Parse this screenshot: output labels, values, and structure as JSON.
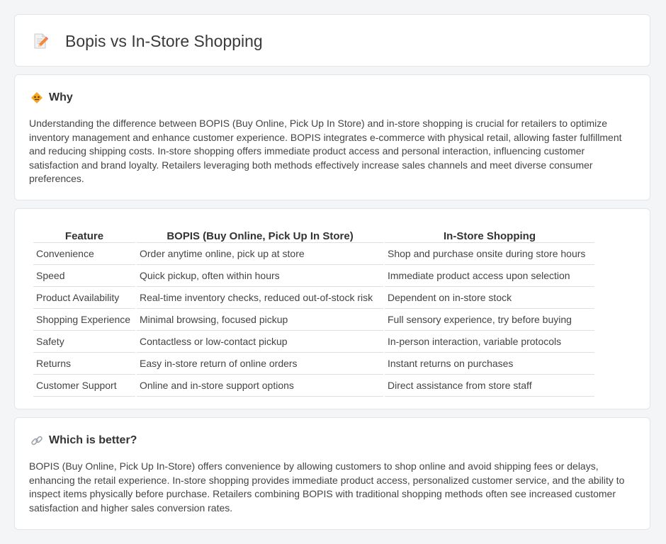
{
  "header": {
    "title": "Bopis vs In-Store Shopping",
    "icon": "document-pencil-icon"
  },
  "why": {
    "icon": "warning-diamond-icon",
    "title": "Why",
    "text": "Understanding the difference between BOPIS (Buy Online, Pick Up In Store) and in-store shopping is crucial for retailers to optimize inventory management and enhance customer experience. BOPIS integrates e-commerce with physical retail, allowing faster fulfillment and reducing shipping costs. In-store shopping offers immediate product access and personal interaction, influencing customer satisfaction and brand loyalty. Retailers leveraging both methods effectively increase sales channels and meet diverse consumer preferences."
  },
  "table": {
    "headers": [
      "Feature",
      "BOPIS (Buy Online, Pick Up In Store)",
      "In-Store Shopping"
    ],
    "rows": [
      [
        "Convenience",
        "Order anytime online, pick up at store",
        "Shop and purchase onsite during store hours"
      ],
      [
        "Speed",
        "Quick pickup, often within hours",
        "Immediate product access upon selection"
      ],
      [
        "Product Availability",
        "Real-time inventory checks, reduced out-of-stock risk",
        "Dependent on in-store stock"
      ],
      [
        "Shopping Experience",
        "Minimal browsing, focused pickup",
        "Full sensory experience, try before buying"
      ],
      [
        "Safety",
        "Contactless or low-contact pickup",
        "In-person interaction, variable protocols"
      ],
      [
        "Returns",
        "Easy in-store return of online orders",
        "Instant returns on purchases"
      ],
      [
        "Customer Support",
        "Online and in-store support options",
        "Direct assistance from store staff"
      ]
    ]
  },
  "better": {
    "icon": "link-icon",
    "title": "Which is better?",
    "text": "BOPIS (Buy Online, Pick Up In-Store) offers convenience by allowing customers to shop online and avoid shipping fees or delays, enhancing the retail experience. In-store shopping provides immediate product access, personalized customer service, and the ability to inspect items physically before purchase. Retailers combining BOPIS with traditional shopping methods often see increased customer satisfaction and higher sales conversion rates."
  },
  "colors": {
    "background": "#f4f5f7",
    "card": "#ffffff",
    "border": "#e3e5e8",
    "icon_orange": "#f0a030",
    "icon_pink": "#e8708a"
  }
}
